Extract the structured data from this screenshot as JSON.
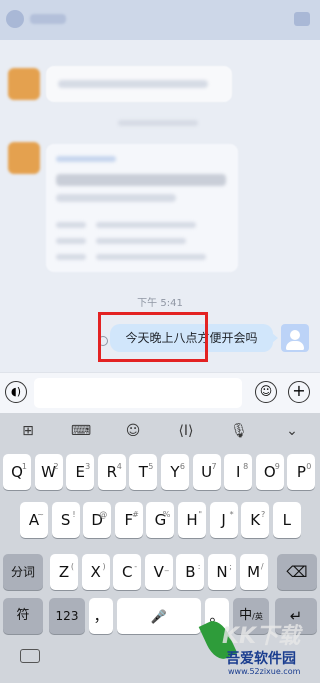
{
  "chat": {
    "time_label": "下午 5:41",
    "message_text": "今天晚上八点方便开会吗"
  },
  "input_bar": {
    "voice_icon": "voice-icon",
    "emoji_icon": "emoji-icon",
    "plus_icon": "plus-icon"
  },
  "keyboard": {
    "toolbar": [
      "grid",
      "keyboard",
      "emoji",
      "cursor",
      "mic",
      "collapse"
    ],
    "row1": [
      "Q",
      "W",
      "E",
      "R",
      "T",
      "Y",
      "U",
      "I",
      "O",
      "P"
    ],
    "row1_hints": [
      "1",
      "2",
      "3",
      "4",
      "5",
      "6",
      "7",
      "8",
      "9",
      "0"
    ],
    "row2": [
      "A",
      "S",
      "D",
      "F",
      "G",
      "H",
      "J",
      "K",
      "L"
    ],
    "row2_hints": [
      "~",
      "!",
      "@",
      "#",
      "%",
      "\"",
      "*",
      "?",
      ""
    ],
    "row3": [
      "Z",
      "X",
      "C",
      "V",
      "B",
      "N",
      "M"
    ],
    "row3_hints": [
      "(",
      ")",
      "-",
      "_",
      ":",
      ";",
      "/"
    ],
    "fenci_label": "分词",
    "symbol_label": "符",
    "num_label": "123",
    "comma_label": "，",
    "period_label": "。",
    "lang_label": "中",
    "lang_sub": "/英",
    "enter_icon": "enter-icon",
    "delete_icon": "backspace-icon"
  },
  "watermark": {
    "cn": "吾爱软件园",
    "url": "www.52zixue.com",
    "big": "KK下载"
  },
  "colors": {
    "highlight": "#e32222",
    "bubble": "#d1e6fb"
  }
}
